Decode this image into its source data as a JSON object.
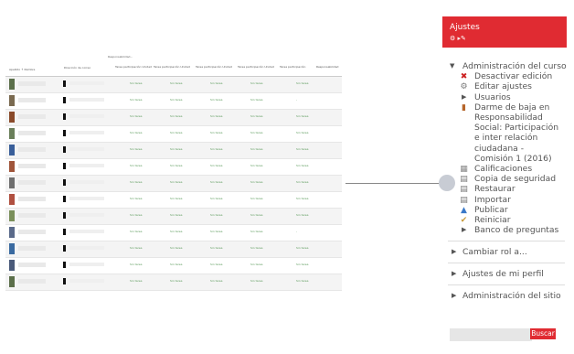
{
  "gradebook": {
    "caption": "Responsabilidad...",
    "headers": {
      "user": "Apellido ↑ Nombre",
      "email": "Dirección de correo",
      "cols": [
        "Tarea participación Unidad",
        "Tarea participación Unidad",
        "Tarea participación Unidad",
        "Tarea participación Unidad",
        "Tarea participación",
        "Responsabilidad"
      ]
    },
    "rows": [
      {
        "cells": [
          "Sin tarea",
          "Sin tarea",
          "Sin tarea",
          "Sin tarea",
          "Sin tarea"
        ]
      },
      {
        "cells": [
          "Sin tarea",
          "Sin tarea",
          "Sin tarea",
          "Sin tarea",
          "-"
        ]
      },
      {
        "cells": [
          "Sin tarea",
          "Sin tarea",
          "Sin tarea",
          "Sin tarea",
          "Sin tarea"
        ]
      },
      {
        "cells": [
          "Sin tarea",
          "Sin tarea",
          "Sin tarea",
          "Sin tarea",
          "Sin tarea"
        ]
      },
      {
        "cells": [
          "Sin tarea",
          "Sin tarea",
          "Sin tarea",
          "Sin tarea",
          "Sin tarea"
        ]
      },
      {
        "cells": [
          "Sin tarea",
          "Sin tarea",
          "Sin tarea",
          "Sin tarea",
          "Sin tarea"
        ]
      },
      {
        "cells": [
          "Sin tarea",
          "Sin tarea",
          "Sin tarea",
          "Sin tarea",
          "Sin tarea"
        ]
      },
      {
        "cells": [
          "Sin tarea",
          "Sin tarea",
          "Sin tarea",
          "Sin tarea",
          "Sin tarea"
        ]
      },
      {
        "cells": [
          "Sin tarea",
          "Sin tarea",
          "Sin tarea",
          "Sin tarea",
          "Sin tarea"
        ]
      },
      {
        "cells": [
          "Sin tarea",
          "Sin tarea",
          "Sin tarea",
          "Sin tarea",
          "-"
        ]
      },
      {
        "cells": [
          "Sin tarea",
          "Sin tarea",
          "Sin tarea",
          "Sin tarea",
          "Sin tarea"
        ]
      },
      {
        "cells": [
          "Sin tarea",
          "Sin tarea",
          "Sin tarea",
          "Sin tarea",
          "Sin tarea"
        ]
      },
      {
        "cells": [
          "Sin tarea",
          "Sin tarea",
          "Sin tarea",
          "Sin tarea",
          "Sin tarea"
        ]
      }
    ],
    "avatar_colors": [
      "#5b6f4a",
      "#7a6a50",
      "#8a4a2a",
      "#6a7f5a",
      "#3a5f9a",
      "#a0553a",
      "#6f6f6f",
      "#b05040",
      "#7a8f5a",
      "#5a6a8a",
      "#3a6aa0",
      "#4a5a7a",
      "#5b6f4a"
    ]
  },
  "settings": {
    "title": "Ajustes",
    "header_icons": "⚙ ▸✎",
    "course_admin": "Administración del curso",
    "items": [
      {
        "label": "Desactivar edición",
        "icon": "✖",
        "icon_color": "#cc2222"
      },
      {
        "label": "Editar ajustes",
        "icon": "⚙",
        "icon_color": "#777777"
      },
      {
        "label": "Usuarios",
        "icon": "▶",
        "icon_color": "#555555"
      },
      {
        "label": "Darme de baja en Responsabilidad Social: Participación e inter relación ciudadana - Comisión 1 (2016)",
        "icon": "▮",
        "icon_color": "#b5652a"
      },
      {
        "label": "Calificaciones",
        "icon": "▦",
        "icon_color": "#888888"
      },
      {
        "label": "Copia de seguridad",
        "icon": "▤",
        "icon_color": "#777777"
      },
      {
        "label": "Restaurar",
        "icon": "▤",
        "icon_color": "#777777"
      },
      {
        "label": "Importar",
        "icon": "▤",
        "icon_color": "#777777"
      },
      {
        "label": "Publicar",
        "icon": "▲",
        "icon_color": "#3a78c8"
      },
      {
        "label": "Reiniciar",
        "icon": "✔",
        "icon_color": "#c89a3a"
      },
      {
        "label": "Banco de preguntas",
        "icon": "▶",
        "icon_color": "#555555"
      }
    ],
    "role": "Cambiar rol a...",
    "profile": "Ajustes de mi perfil",
    "site_admin": "Administración del sitio",
    "search_placeholder": "",
    "search_button": "Buscar"
  },
  "colors": {
    "accent": "#e02b32",
    "connector_dot": "#c8ccd4"
  }
}
